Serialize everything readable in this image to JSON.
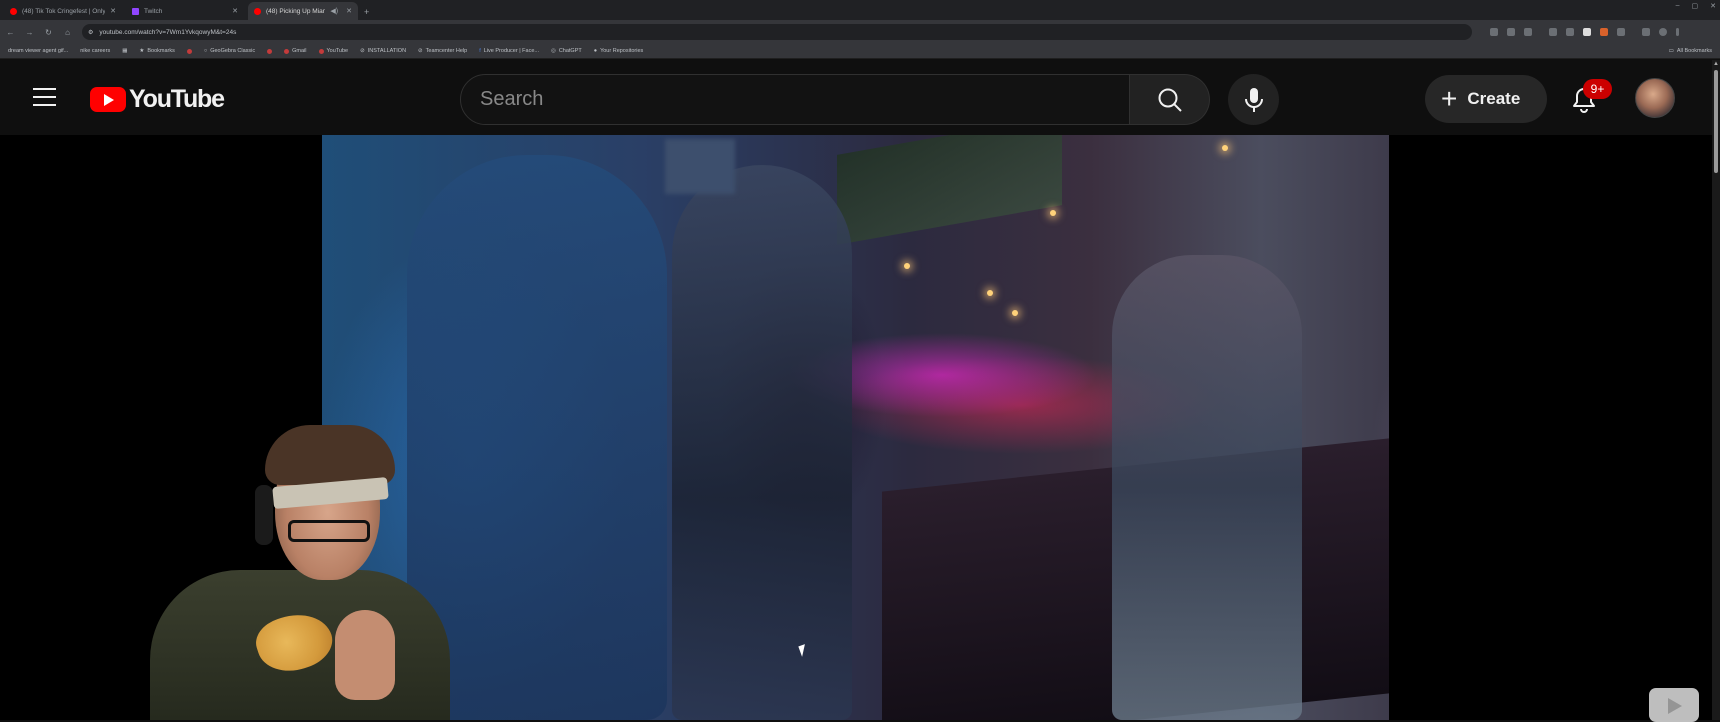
{
  "browser": {
    "tabs": [
      {
        "title": "(48) Tik Tok Cringefest | Only t...",
        "active": false,
        "favicon_color": "#ff0000"
      },
      {
        "title": "Twitch",
        "active": false,
        "favicon_color": "#9146ff"
      },
      {
        "title": "(48) Picking Up Miami Girl...",
        "active": true,
        "favicon_color": "#ff0000"
      }
    ],
    "new_tab": "+",
    "window_controls": [
      "–",
      "▢",
      "✕"
    ],
    "url": "youtube.com/watch?v=7Wm1YvkqowyM&t=24s",
    "bookmarks": [
      "dream viewer agent gif...",
      "nike careers",
      "Bookmarks",
      "GeoGebra Classic",
      "Gmail",
      "YouTube",
      "INSTALLATION",
      "Teamcenter Help",
      "Live Producer | Face...",
      "ChatGPT",
      "Your Repositories"
    ],
    "all_bookmarks": "All Bookmarks"
  },
  "youtube": {
    "logo_text": "YouTube",
    "search_placeholder": "Search",
    "create_label": "Create",
    "notification_count": "9+"
  },
  "colors": {
    "brand_red": "#ff0000",
    "badge_red": "#cc0000",
    "background": "#0f0f0f"
  }
}
